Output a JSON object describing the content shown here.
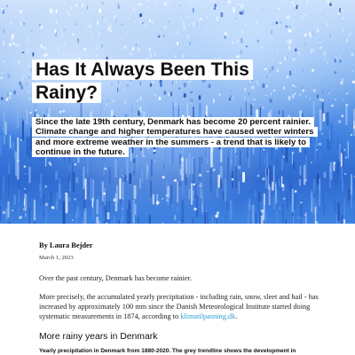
{
  "hero": {
    "title": "Has It Always Been This Rainy?",
    "subtitle": "Since the late 19th century, Denmark has become 20 percent rainier. Climate change and higher temperatures have caused wetter winters and more extreme weather in the summers - a trend that is likely to continue in the future.",
    "colors": {
      "light": "#cfe2fb",
      "mid": "#3d7fe0",
      "deep": "#2f6ad0"
    }
  },
  "article": {
    "byline": "By Laura Bejder",
    "date": "March 1, 2023",
    "paragraph1": "Over the past century, Denmark has become rainier.",
    "paragraph2_before": "More precisely, the accumulated yearly precipitation - including rain, snow, sleet and hail - has increased by approximately 100 mm since the Danish Meteorological Institute started doing systematic measurements in 1874, according to ",
    "paragraph2_link": "klimatilpasning.dk",
    "paragraph2_after": ".",
    "section_heading": "More rainy years in Denmark",
    "caption": "Yearly precipitation in Denmark from 1880-2020. The grey trendline shows the development in",
    "link_color": "#2a9fd6"
  }
}
